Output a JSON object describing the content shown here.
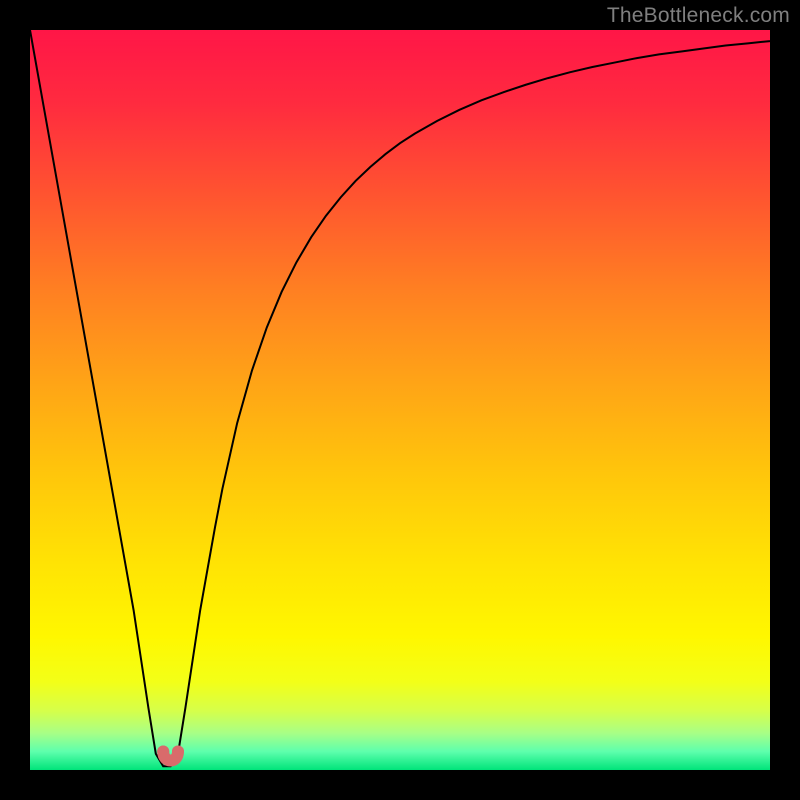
{
  "attribution": "TheBottleneck.com",
  "colors": {
    "frame": "#000000",
    "curve": "#000000",
    "marker": "#d96b6b",
    "attribution": "#7f7f7f"
  },
  "gradient_stops": [
    {
      "offset": 0.0,
      "color": "#ff1647"
    },
    {
      "offset": 0.1,
      "color": "#ff2b3f"
    },
    {
      "offset": 0.22,
      "color": "#ff5330"
    },
    {
      "offset": 0.35,
      "color": "#ff7f22"
    },
    {
      "offset": 0.48,
      "color": "#ffa516"
    },
    {
      "offset": 0.6,
      "color": "#ffc60b"
    },
    {
      "offset": 0.72,
      "color": "#ffe304"
    },
    {
      "offset": 0.82,
      "color": "#fff700"
    },
    {
      "offset": 0.88,
      "color": "#f3ff17"
    },
    {
      "offset": 0.92,
      "color": "#d6ff4a"
    },
    {
      "offset": 0.95,
      "color": "#a8ff86"
    },
    {
      "offset": 0.975,
      "color": "#5effad"
    },
    {
      "offset": 1.0,
      "color": "#00e47a"
    }
  ],
  "chart_data": {
    "type": "line",
    "title": "",
    "xlabel": "",
    "ylabel": "",
    "xlim": [
      0,
      100
    ],
    "ylim": [
      0,
      100
    ],
    "x": [
      0,
      1,
      2,
      3,
      4,
      5,
      6,
      7,
      8,
      9,
      10,
      11,
      12,
      13,
      14,
      15,
      16,
      17,
      18,
      19,
      20,
      21,
      22,
      23,
      24,
      25,
      26,
      28,
      30,
      32,
      34,
      36,
      38,
      40,
      42,
      44,
      46,
      48,
      50,
      52,
      55,
      58,
      61,
      64,
      67,
      70,
      73,
      76,
      79,
      82,
      85,
      88,
      91,
      94,
      97,
      100
    ],
    "y": [
      100,
      94.4,
      88.8,
      83.2,
      77.6,
      72.0,
      66.4,
      60.8,
      55.2,
      49.6,
      44.0,
      38.4,
      32.8,
      27.2,
      21.6,
      15.0,
      8.4,
      2.2,
      0.5,
      0.5,
      2.2,
      8.4,
      15.0,
      21.6,
      27.2,
      32.8,
      38.0,
      46.9,
      54.0,
      59.8,
      64.6,
      68.6,
      72.0,
      74.9,
      77.4,
      79.6,
      81.5,
      83.2,
      84.7,
      86.0,
      87.7,
      89.2,
      90.5,
      91.6,
      92.6,
      93.5,
      94.3,
      95.0,
      95.6,
      96.2,
      96.7,
      97.1,
      97.5,
      97.9,
      98.2,
      98.5
    ],
    "marker_left": {
      "x": 18.0,
      "y": 2.5
    },
    "marker_right": {
      "x": 20.0,
      "y": 2.5
    },
    "notes": "V-shaped bottleneck curve; minimum around x≈18–20; y values estimated from vertical position on gradient background (0 at bottom green band, 100 at top red)."
  }
}
